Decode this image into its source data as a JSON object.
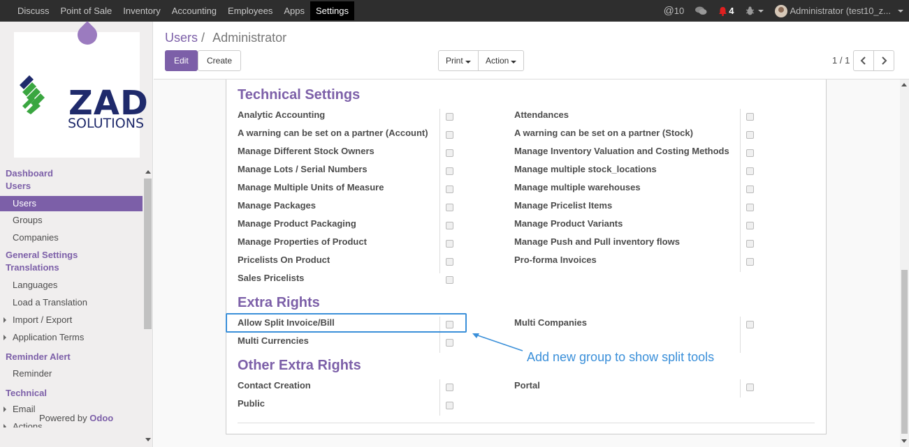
{
  "topbar": {
    "menu": [
      "Discuss",
      "Point of Sale",
      "Inventory",
      "Accounting",
      "Employees",
      "Apps",
      "Settings"
    ],
    "active_menu": "Settings",
    "mentions": "10",
    "notifications": "4",
    "user": "Administrator (test10_z..."
  },
  "sidebar": {
    "logo_main": "ZAD",
    "logo_sub": "SOLUTIONS",
    "sections": [
      {
        "title": "Dashboard",
        "items": []
      },
      {
        "title": "Users",
        "items": [
          "Users",
          "Groups",
          "Companies"
        ]
      },
      {
        "title": "General Settings",
        "items": []
      },
      {
        "title": "Translations",
        "items": [
          "Languages",
          "Load a Translation",
          "Import / Export",
          "Application Terms"
        ]
      },
      {
        "title": "Reminder Alert",
        "items": [
          "Reminder"
        ]
      },
      {
        "title": "Technical",
        "items": [
          "Email",
          "Actions"
        ]
      }
    ],
    "active_item": "Users",
    "powered_by": "Powered by",
    "powered_brand": "Odoo"
  },
  "control_panel": {
    "breadcrumb_parent": "Users",
    "breadcrumb_sep": "/",
    "breadcrumb_current": "Administrator",
    "edit_label": "Edit",
    "create_label": "Create",
    "print_label": "Print",
    "action_label": "Action",
    "pager": "1 / 1"
  },
  "form": {
    "technical_title": "Technical Settings",
    "technical_left": [
      "Analytic Accounting",
      "A warning can be set on a partner (Account)",
      "Manage Different Stock Owners",
      "Manage Lots / Serial Numbers",
      "Manage Multiple Units of Measure",
      "Manage Packages",
      "Manage Product Packaging",
      "Manage Properties of Product",
      "Pricelists On Product",
      "Sales Pricelists"
    ],
    "technical_right": [
      "Attendances",
      "A warning can be set on a partner (Stock)",
      "Manage Inventory Valuation and Costing Methods",
      "Manage multiple stock_locations",
      "Manage multiple warehouses",
      "Manage Pricelist Items",
      "Manage Product Variants",
      "Manage Push and Pull inventory flows",
      "Pro-forma Invoices"
    ],
    "extra_title": "Extra Rights",
    "extra_left": [
      "Allow Split Invoice/Bill",
      "Multi Currencies"
    ],
    "extra_right": [
      "Multi Companies"
    ],
    "other_title": "Other Extra Rights",
    "other_left": [
      "Contact Creation",
      "Public"
    ],
    "other_right": [
      "Portal"
    ]
  },
  "annotation": "Add new group to show split tools",
  "colors": {
    "brand": "#7c5fa8",
    "annotation": "#3a8fd9",
    "topbar": "#2e2e2e",
    "alert": "#e02020"
  }
}
